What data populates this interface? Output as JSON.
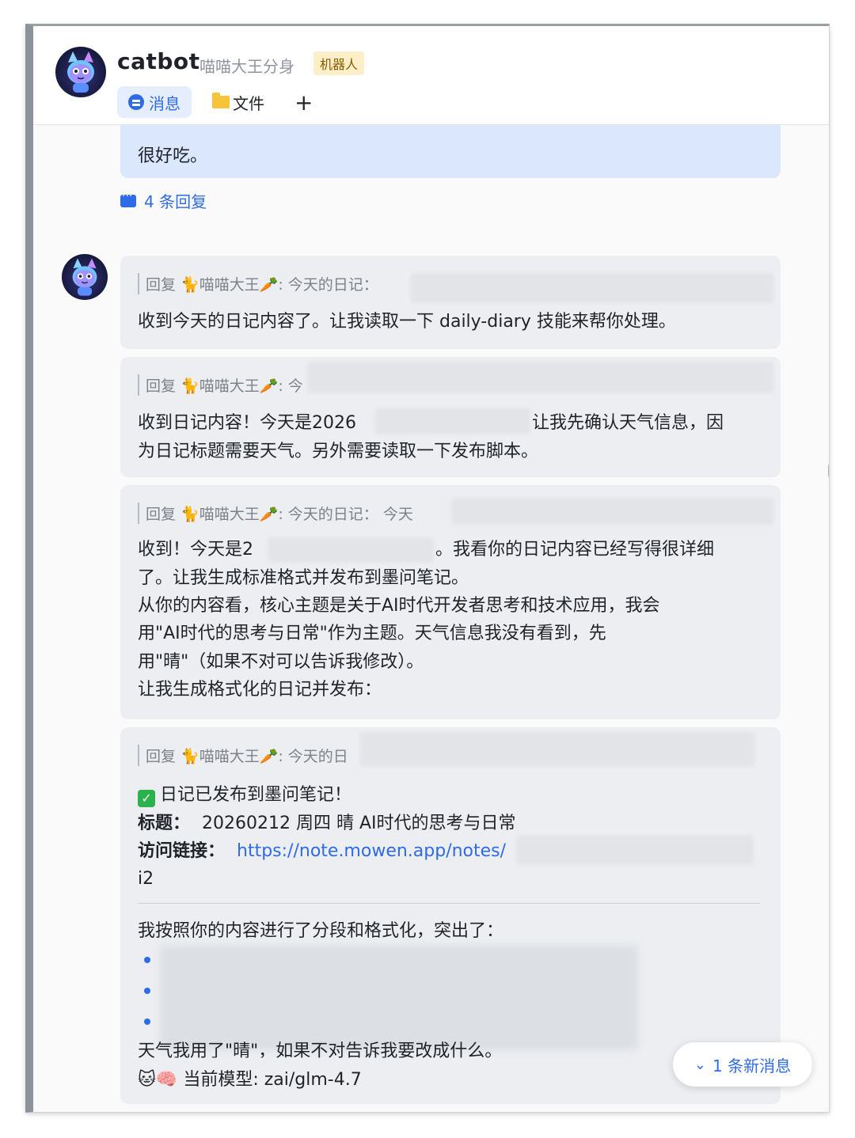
{
  "header": {
    "title": "catbot",
    "subtitle": "喵喵大王分身",
    "badge": "机器人",
    "tabs": [
      {
        "label": "消息",
        "icon": "chat-bubble-icon"
      },
      {
        "label": "文件",
        "icon": "folder-icon"
      },
      {
        "label": "+",
        "icon": "plus-icon"
      }
    ]
  },
  "thread": {
    "top_message_tail": "很好吃。",
    "replies_label": "4 条回复",
    "messages": [
      {
        "quote": "回复 🐈喵喵大王🥕: 今天的日记：",
        "lines": [
          "收到今天的日记内容了。让我读取一下 daily-diary 技能来帮你处理。"
        ]
      },
      {
        "quote": "回复 🐈喵喵大王🥕: 今",
        "lines": [
          "收到日记内容！今天是2026",
          "让我先确认天气信息，因",
          "为日记标题需要天气。另外需要读取一下发布脚本。"
        ]
      },
      {
        "quote": "回复 🐈喵喵大王🥕: 今天的日记： 今天",
        "lines": [
          "收到！今天是2",
          "。我看你的日记内容已经写得很详细",
          "了。让我生成标准格式并发布到墨问笔记。",
          "从你的内容看，核心主题是关于AI时代开发者思考和技术应用，我会",
          "用\"AI时代的思考与日常\"作为主题。天气信息我没有看到，先",
          "用\"晴\"（如果不对可以告诉我修改）。",
          "让我生成格式化的日记并发布："
        ]
      },
      {
        "quote": "回复 🐈喵喵大王🥕: 今天的日",
        "published": "日记已发布到墨问笔记！",
        "title_label": "标题：",
        "title_value": "20260212 周四  晴  AI时代的思考与日常",
        "link_label": "访问链接：",
        "link_value": "https://note.mowen.app/notes/",
        "link_tail": "i2",
        "summary": "我按照你的内容进行了分段和格式化，突出了：",
        "weather_line": "天气我用了\"晴\"，如果不对告诉我要改成什么。",
        "model_line": "🐱🧠 当前模型: zai/glm-4.7"
      }
    ]
  },
  "new_messages": "1 条新消息"
}
